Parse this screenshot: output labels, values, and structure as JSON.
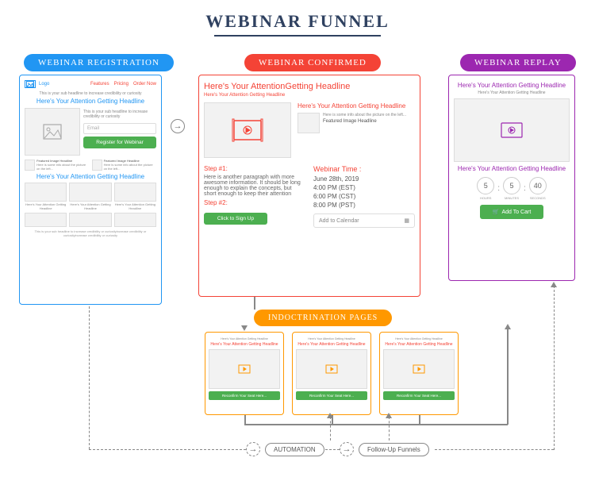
{
  "title": "WEBINAR FUNNEL",
  "banners": {
    "registration": "WEBINAR REGISTRATION",
    "confirmed": "WEBINAR CONFIRMED",
    "replay": "WEBINAR REPLAY",
    "indoctrination": "INDOCTRINATION PAGES"
  },
  "registration": {
    "logo": "Logo",
    "nav": {
      "features": "Features",
      "pricing": "Pricing",
      "order": "Order Now"
    },
    "sub1": "This is your sub headline to increase credibility or curiosity",
    "headline": "Here's Your Attention Getting Headline",
    "sub2": "This is your sub headline to increase credibility or curiosity",
    "email_placeholder": "Email",
    "button": "Register for Webinar",
    "feat_title": "Featured Image Headline",
    "feat_text": "Here is some info about the picture on the left...",
    "headline2": "Here's Your Attention Getting Headline",
    "thumb_caption": "Here's Your Attention Getting Headline",
    "footer": "This is your sub headline to increase credibility or curiosityincrease credibility or curiosityincrease credibility or curiosity"
  },
  "confirmed": {
    "headline": "Here's Your AttentionGetting Headline",
    "sub": "Here's Your Attention Getting Headline",
    "side_headline": "Here's Your Attention Getting Headline",
    "side_info": "Here is some info about the picture on the left...",
    "side_feat": "Featured Image Headline",
    "step1": "Step #1:",
    "para": "Here is another paragraph with more awesome information. It should be long enough to explain the concepts, but short enough to keep their attention",
    "step2": "Step #2:",
    "signup": "Click to Sign Up",
    "wt_label": "Webinar Time :",
    "date": "June 28th, 2019",
    "t1": "4:00 PM (EST)",
    "t2": "6:00 PM (CST)",
    "t3": "8:00 PM (PST)",
    "calendar": "Add to Calendar"
  },
  "replay": {
    "headline": "Here's Your Attention Getting Headline",
    "sub": "Here's Your Attention Getting Headline",
    "headline2": "Here's Your Attention Getting Headline",
    "hours": "5",
    "minutes": "5",
    "seconds": "40",
    "hours_l": "HOURS",
    "minutes_l": "MINUTES",
    "seconds_l": "SECONDS",
    "button": "Add To Cart"
  },
  "indoc": {
    "sub": "Here's Your Attention Getting Headline",
    "headline": "Here's Your Attention Getting Headline",
    "button": "Reconfirm Your Seat Here..."
  },
  "flow": {
    "automation": "AUTOMATION",
    "followup": "Follow-Up Funnels"
  }
}
